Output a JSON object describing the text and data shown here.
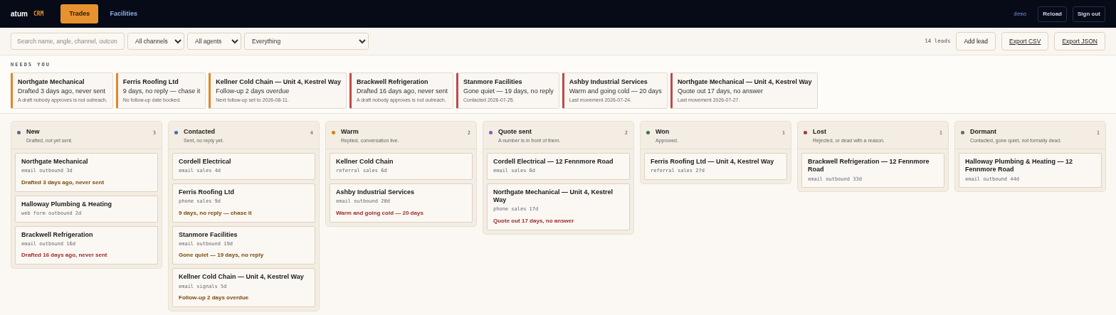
{
  "brand": {
    "name": "atum",
    "tag": "CRM"
  },
  "tabs": [
    {
      "label": "Trades",
      "selected": true
    },
    {
      "label": "Facilities",
      "selected": false
    }
  ],
  "user": "demo",
  "nav_buttons": [
    "Reload",
    "Sign out"
  ],
  "toolbar": {
    "search": {
      "placeholder": "Search name, angle, channel, outcon"
    },
    "filters": [
      {
        "value": "All channels"
      },
      {
        "value": "All agents"
      },
      {
        "value": "Everything"
      }
    ],
    "count": "14 leads",
    "buttons": [
      {
        "label": "Add lead",
        "underlined": false
      },
      {
        "label": "Export CSV",
        "underlined": true
      },
      {
        "label": "Export JSON",
        "underlined": true
      }
    ]
  },
  "needs_you": {
    "title": "NEEDS YOU",
    "items": [
      {
        "name": "Northgate Mechanical",
        "reason": "Drafted 3 days ago, never sent",
        "detail": "A draft nobody approves is not outreach.",
        "color": "#e0862a"
      },
      {
        "name": "Ferris Roofing Ltd",
        "reason": "9 days, no reply — chase it",
        "detail": "No follow-up date booked.",
        "color": "#e0862a"
      },
      {
        "name": "Kellner Cold Chain — Unit 4, Kestrel Way",
        "reason": "Follow-up 2 days overdue",
        "detail": "Next follow-up set to 2026-08-11.",
        "color": "#e0862a"
      },
      {
        "name": "Brackwell Refrigeration",
        "reason": "Drafted 16 days ago, never sent",
        "detail": "A draft nobody approves is not outreach.",
        "color": "#c04848"
      },
      {
        "name": "Stanmore Facilities",
        "reason": "Gone quiet — 19 days, no reply",
        "detail": "Contacted 2026-07-25.",
        "color": "#c04848"
      },
      {
        "name": "Ashby Industrial Services",
        "reason": "Warm and going cold — 20 days",
        "detail": "Last movement 2026-07-24.",
        "color": "#c04848"
      },
      {
        "name": "Northgate Mechanical — Unit 4, Kestrel Way",
        "reason": "Quote out 17 days, no answer",
        "detail": "Last movement 2026-07-27.",
        "color": "#c04848"
      }
    ]
  },
  "columns": [
    {
      "title": "New",
      "subtitle": "Drafted, not yet sent.",
      "count": "3",
      "color": "#5a6a8c",
      "leads": [
        {
          "name": "Northgate Mechanical",
          "meta": "email outbound 3d",
          "note": "Drafted 3 days ago, never sent",
          "color": "#7a4a0a"
        },
        {
          "name": "Halloway Plumbing & Heating",
          "meta": "web form outbound 2d"
        },
        {
          "name": "Brackwell Refrigeration",
          "meta": "email outbound 16d",
          "note": "Drafted 16 days ago, never sent",
          "color": "#9a2a2a"
        }
      ]
    },
    {
      "title": "Contacted",
      "subtitle": "Sent, no reply yet.",
      "count": "4",
      "color": "#3a6fb8",
      "leads": [
        {
          "name": "Cordell Electrical",
          "meta": "email sales 4d"
        },
        {
          "name": "Ferris Roofing Ltd",
          "meta": "phone sales 9d",
          "note": "9 days, no reply — chase it",
          "color": "#7a4a0a"
        },
        {
          "name": "Stanmore Facilities",
          "meta": "email outbound 19d",
          "note": "Gone quiet — 19 days, no reply",
          "color": "#7a4a0a"
        },
        {
          "name": "Kellner Cold Chain — Unit 4, Kestrel Way",
          "meta": "email signals 5d",
          "note": "Follow-up 2 days overdue",
          "color": "#7a4a0a"
        }
      ]
    },
    {
      "title": "Warm",
      "subtitle": "Replied, conversation live.",
      "count": "2",
      "color": "#d0801a",
      "leads": [
        {
          "name": "Kellner Cold Chain",
          "meta": "referral sales 6d"
        },
        {
          "name": "Ashby Industrial Services",
          "meta": "email outbound 20d",
          "note": "Warm and going cold — 20 days",
          "color": "#9a2a2a"
        }
      ]
    },
    {
      "title": "Quote sent",
      "subtitle": "A number is in front of them.",
      "count": "2",
      "color": "#8a5ab0",
      "leads": [
        {
          "name": "Cordell Electrical — 12 Fennmore Road",
          "meta": "email sales 6d"
        },
        {
          "name": "Northgate Mechanical — Unit 4, Kestrel Way",
          "meta": "phone sales 17d",
          "note": "Quote out 17 days, no answer",
          "color": "#9a2a2a"
        }
      ]
    },
    {
      "title": "Won",
      "subtitle": "Approved.",
      "count": "1",
      "color": "#2f7a3e",
      "leads": [
        {
          "name": "Ferris Roofing Ltd — Unit 4, Kestrel Way",
          "meta": "referral sales 27d"
        }
      ]
    },
    {
      "title": "Lost",
      "subtitle": "Rejected, or dead with a reason.",
      "count": "1",
      "color": "#a33a3a",
      "leads": [
        {
          "name": "Brackwell Refrigeration — 12 Fennmore Road",
          "meta": "email outbound 33d"
        }
      ]
    },
    {
      "title": "Dormant",
      "subtitle": "Contacted, gone quiet, not formally dead.",
      "count": "1",
      "color": "#6e6a60",
      "leads": [
        {
          "name": "Halloway Plumbing & Heating — 12 Fennmore Road",
          "meta": "email outbound 44d"
        }
      ]
    }
  ]
}
